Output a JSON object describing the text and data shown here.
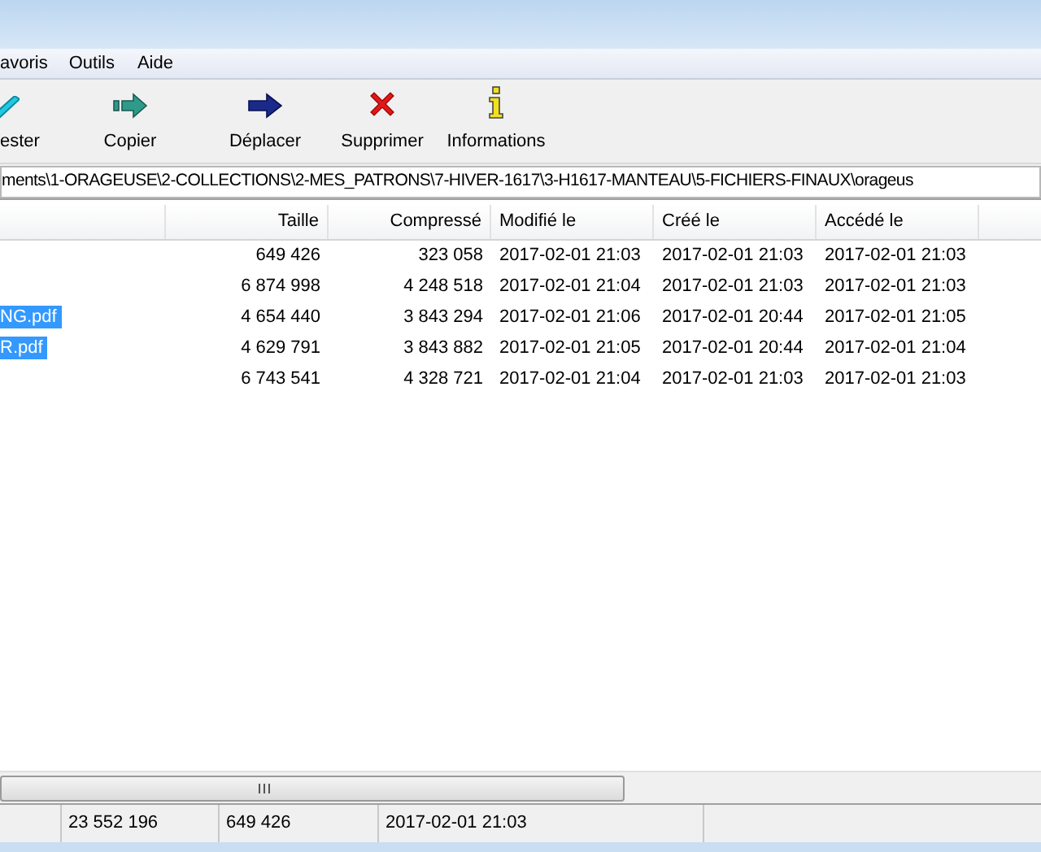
{
  "menu": [
    "avoris",
    "Outils",
    "Aide"
  ],
  "toolbar": [
    {
      "kind": "test",
      "label": "ester"
    },
    {
      "kind": "copy",
      "label": "Copier"
    },
    {
      "kind": "move",
      "label": "Déplacer"
    },
    {
      "kind": "delete",
      "label": "Supprimer"
    },
    {
      "kind": "info",
      "label": "Informations"
    }
  ],
  "address": "ments\\1-ORAGEUSE\\2-COLLECTIONS\\2-MES_PATRONS\\7-HIVER-1617\\3-H1617-MANTEAU\\5-FICHIERS-FINAUX\\orageus",
  "table": {
    "columns": [
      "Taille",
      "Compressé",
      "Modifié le",
      "Créé le",
      "Accédé le"
    ],
    "rows": [
      {
        "name": "",
        "selected": false,
        "cells": [
          "649 426",
          "323 058",
          "2017-02-01 21:03",
          "2017-02-01 21:03",
          "2017-02-01 21:03"
        ]
      },
      {
        "name": "",
        "selected": false,
        "cells": [
          "6 874 998",
          "4 248 518",
          "2017-02-01 21:04",
          "2017-02-01 21:03",
          "2017-02-01 21:03"
        ]
      },
      {
        "name": "NG.pdf",
        "selected": true,
        "cells": [
          "4 654 440",
          "3 843 294",
          "2017-02-01 21:06",
          "2017-02-01 20:44",
          "2017-02-01 21:05"
        ]
      },
      {
        "name": "R.pdf",
        "selected": true,
        "cells": [
          "4 629 791",
          "3 843 882",
          "2017-02-01 21:05",
          "2017-02-01 20:44",
          "2017-02-01 21:04"
        ]
      },
      {
        "name": "",
        "selected": false,
        "cells": [
          "6 743 541",
          "4 328 721",
          "2017-02-01 21:04",
          "2017-02-01 21:03",
          "2017-02-01 21:03"
        ]
      }
    ]
  },
  "status_bar": [
    "23 552 196",
    "649 426",
    "2017-02-01 21:03"
  ]
}
